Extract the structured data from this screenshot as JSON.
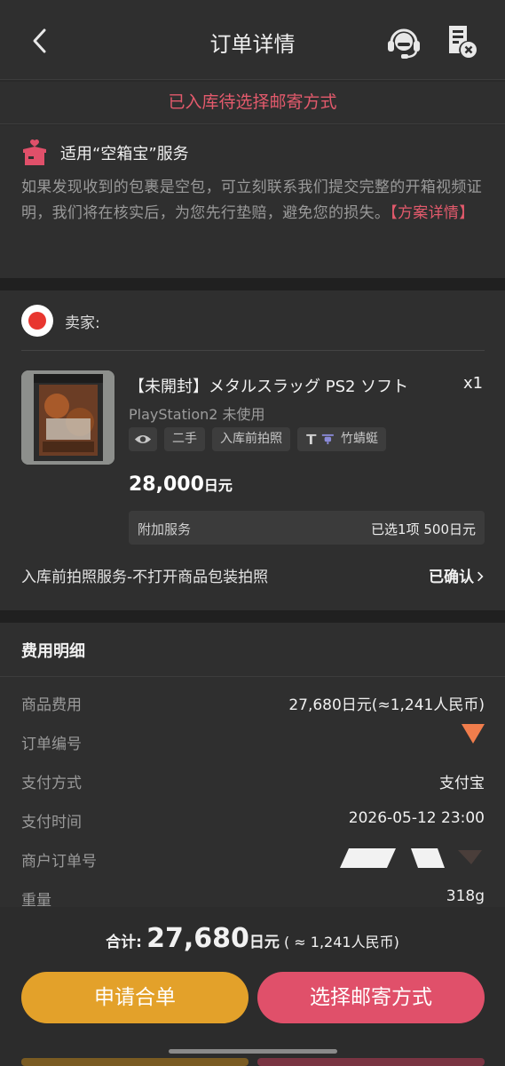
{
  "header": {
    "title": "订单详情",
    "back_icon": "chevron-left-icon",
    "support_icon": "headset-icon",
    "invoice_icon": "document-cancel-icon"
  },
  "status": {
    "text": "已入库待选择邮寄方式",
    "color": "#e35a6c"
  },
  "guarantee": {
    "icon": "box-with-heart-icon",
    "title": "适用“空箱宝”服务",
    "description": "如果发现收到的包裹是空包，可立刻联系我们提交完整的开箱视频证明，我们将在核实后，为您先行垫赔，避免您的损失。",
    "link_text": "【方案详情】"
  },
  "seller": {
    "label": "卖家:",
    "logo": "mercari-logo"
  },
  "product": {
    "title": "【未開封】メタルスラッグ PS2 ソフト",
    "qty": "x1",
    "variant": "PlayStation2 未使用",
    "tags": [
      "二手",
      "入库前拍照",
      "竹蜻蜓"
    ],
    "price_amount": "28,000",
    "price_unit": "日元",
    "addon_label": "附加服务",
    "addon_value": "已选1项 500日元",
    "photo_service_label": "入库前拍照服务-不打开商品包装拍照",
    "photo_service_status": "已确认"
  },
  "fees": {
    "title": "费用明细",
    "rows": [
      {
        "label": "商品费用",
        "value": "27,680日元(≈1,241人民币)"
      },
      {
        "label": "订单编号",
        "value": ""
      },
      {
        "label": "支付方式",
        "value": "支付宝"
      },
      {
        "label": "支付时间",
        "value": "2026-05-12 23:00"
      },
      {
        "label": "商户订单号",
        "value": ""
      },
      {
        "label": "重量",
        "value": "318g"
      }
    ]
  },
  "footer": {
    "total_label": "合计:",
    "total_amount": "27,680",
    "total_unit": "日元",
    "total_cny": "( ≈ 1,241人民币)",
    "merge_button": "申请合单",
    "ship_button": "选择邮寄方式"
  },
  "colors": {
    "accent_red": "#e0506a",
    "accent_orange": "#e3a12a",
    "background": "#2f2f2f"
  }
}
